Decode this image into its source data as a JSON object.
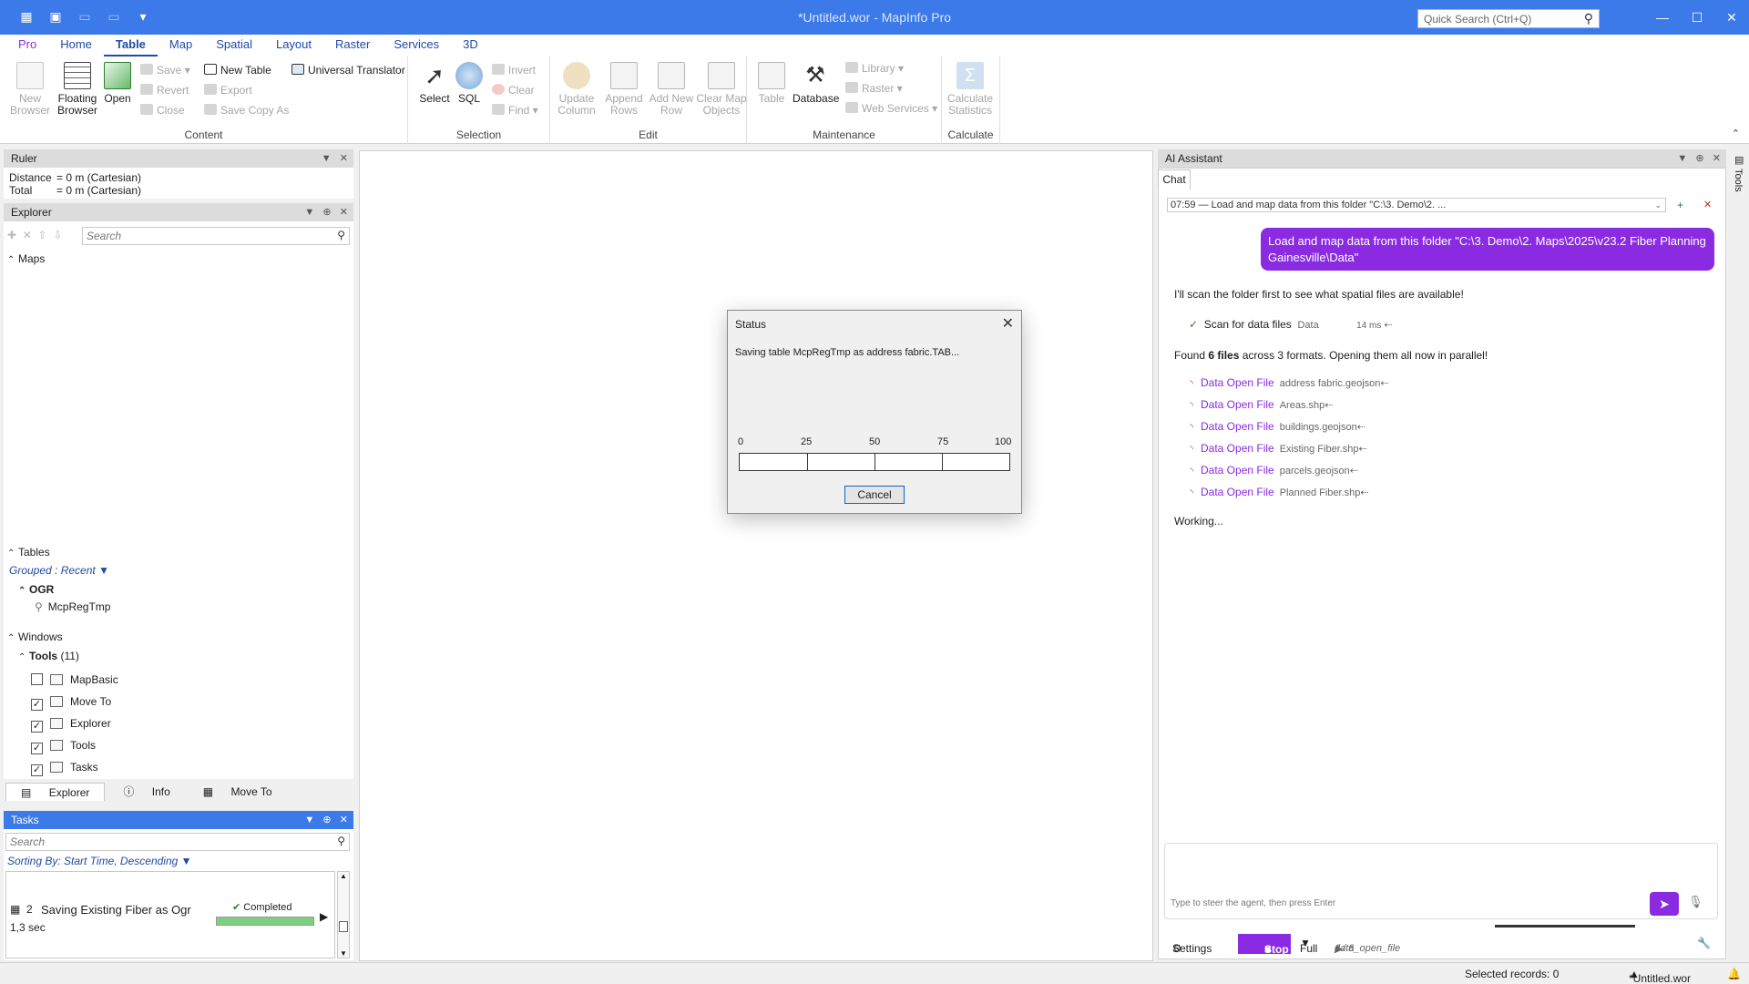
{
  "window": {
    "title": "*Untitled.wor - MapInfo Pro",
    "quick_search_placeholder": "Quick Search (Ctrl+Q)"
  },
  "ribbon_tabs": [
    "Pro",
    "Home",
    "Table",
    "Map",
    "Spatial",
    "Layout",
    "Raster",
    "Services",
    "3D"
  ],
  "ribbon": {
    "content": {
      "name": "Content",
      "new_browser": "New Browser",
      "floating_browser": "Floating Browser",
      "open": "Open",
      "save": "Save",
      "revert": "Revert",
      "close": "Close",
      "new_table": "New Table",
      "export": "Export",
      "save_copy_as": "Save Copy As",
      "universal_translator": "Universal Translator"
    },
    "selection": {
      "name": "Selection",
      "select": "Select",
      "sql": "SQL",
      "invert": "Invert",
      "clear": "Clear",
      "find": "Find"
    },
    "edit": {
      "name": "Edit",
      "update_column": "Update Column",
      "append_rows": "Append Rows",
      "add_new_row": "Add New Row",
      "clear_map_objects": "Clear Map Objects"
    },
    "maintenance": {
      "name": "Maintenance",
      "table": "Table",
      "database": "Database",
      "library": "Library",
      "raster": "Raster",
      "web_services": "Web Services"
    },
    "calculate": {
      "name": "Calculate",
      "calculate_statistics": "Calculate Statistics"
    }
  },
  "ruler": {
    "title": "Ruler",
    "distance_label": "Distance",
    "distance_value": "= 0 m (Cartesian)",
    "total_label": "Total",
    "total_value": "= 0 m (Cartesian)"
  },
  "explorer": {
    "title": "Explorer",
    "search_placeholder": "Search",
    "maps_label": "Maps",
    "tables_label": "Tables",
    "grouped_label": "Grouped : Recent",
    "ogr_label": "OGR",
    "table_item": "McpRegTmp",
    "windows_label": "Windows",
    "tools_label": "Tools",
    "tools_count": "(11)",
    "tools_items": [
      {
        "label": "MapBasic",
        "checked": false
      },
      {
        "label": "Move To",
        "checked": true
      },
      {
        "label": "Explorer",
        "checked": true
      },
      {
        "label": "Tools",
        "checked": true
      },
      {
        "label": "Tasks",
        "checked": true
      }
    ]
  },
  "bottom_tabs": [
    "Explorer",
    "Info",
    "Move To"
  ],
  "tasks": {
    "title": "Tasks",
    "search_placeholder": "Search",
    "sorting": "Sorting By: Start Time, Descending",
    "item_number": "2",
    "item_title": "Saving Existing Fiber as Ogr",
    "item_status": "Completed",
    "item_duration": "1,3 sec",
    "item_progress": 1.0
  },
  "status_dialog": {
    "title": "Status",
    "message": "Saving table McpRegTmp as address fabric.TAB...",
    "scale": [
      "0",
      "25",
      "50",
      "75",
      "100"
    ],
    "progress": 0,
    "cancel_label": "Cancel"
  },
  "ai_assistant": {
    "title": "AI Assistant",
    "chat_tab": "Chat",
    "conversation_select": "07:59  —  Load and map data from this folder \"C:\\3. Demo\\2. ...",
    "user_message": "Load and map data from this folder \"C:\\3. Demo\\2. Maps\\2025\\v23.2 Fiber Planning Gainesville\\Data\"",
    "reply_1": "I'll scan the folder first to see what spatial files are available!",
    "scan_step": {
      "label": "Scan for data files",
      "arg": "Data",
      "time": "14 ms"
    },
    "found_prefix": "Found ",
    "found_bold": "6 files",
    "found_suffix": " across 3 formats. Opening them all now in parallel!",
    "tool_calls": [
      {
        "name": "Data Open File",
        "arg": "address fabric.geojson"
      },
      {
        "name": "Data Open File",
        "arg": "Areas.shp"
      },
      {
        "name": "Data Open File",
        "arg": "buildings.geojson"
      },
      {
        "name": "Data Open File",
        "arg": "Existing Fiber.shp"
      },
      {
        "name": "Data Open File",
        "arg": "parcels.geojson"
      },
      {
        "name": "Data Open File",
        "arg": "Planned Fiber.shp"
      }
    ],
    "working": "Working...",
    "input_placeholder": "Type to steer the agent, then press Enter",
    "settings_label": "Settings",
    "stop_label": "Stop",
    "mode_label": "Full",
    "step_counter": "1 / 6",
    "current_tool": "data_open_file"
  },
  "right_rail_label": "Tools",
  "statusbar": {
    "selected_records": "Selected records: 0",
    "workspace": "*Untitled.wor"
  },
  "colors": {
    "titlebar": "#3b7ae8",
    "accent_purple": "#8a2be2",
    "progress_green": "#06b025"
  }
}
